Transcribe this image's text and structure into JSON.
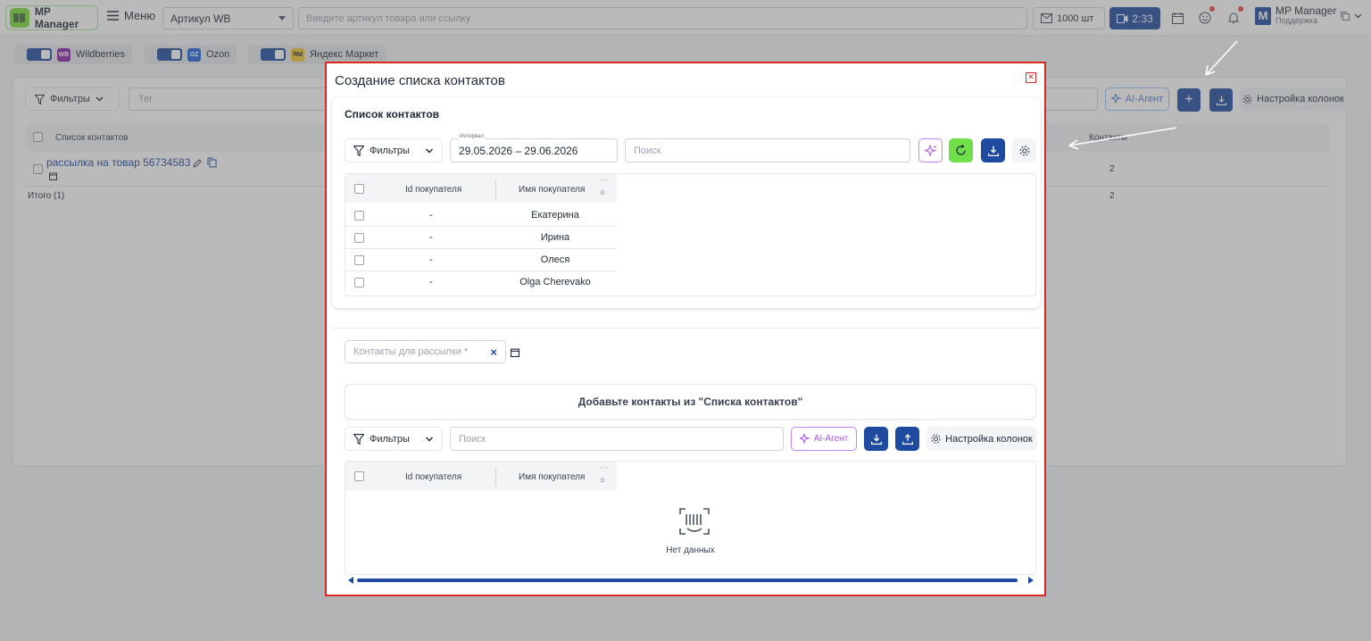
{
  "app": {
    "name": "MP Manager",
    "menu_label": "Меню"
  },
  "topbar": {
    "article_select": "Артикул WB",
    "article_placeholder": "Введите артикул товара или ссылку",
    "count": "1000 шт",
    "timer": "2:33",
    "profile_name": "MP Manager",
    "profile_sub": "Поддержка"
  },
  "marketplaces": [
    {
      "code": "WB",
      "label": "Wildberries",
      "color": "#8b1fa9"
    },
    {
      "code": "OZ",
      "label": "Ozon",
      "color": "#1e63d6"
    },
    {
      "code": "ЯМ",
      "label": "Яндекс Маркет",
      "color": "#f4c430"
    }
  ],
  "background": {
    "filters_label": "Фильтры",
    "tag_placeholder": "Тег",
    "ai_label": "AI-Агент",
    "columns_label": "Настройка колонок",
    "col_list": "Список контактов",
    "col_contacts": "Контакты",
    "row_name": "рассылка на товар 56734583",
    "row_value": "2",
    "total_label": "Итого (1)",
    "total_value": "2"
  },
  "modal": {
    "title": "Создание списка контактов",
    "section1": {
      "title": "Список контактов",
      "filters_label": "Фильтры",
      "date_label": "Интервал",
      "date_value": "29.05.2026 – 29.06.2026",
      "search_placeholder": "Поиск",
      "col_id": "Id покупателя",
      "col_name": "Имя покупателя",
      "rows": [
        {
          "id": "-",
          "name": "Екатерина"
        },
        {
          "id": "-",
          "name": "Ирина"
        },
        {
          "id": "-",
          "name": "Олеся"
        },
        {
          "id": "-",
          "name": "Olga Cherevako"
        }
      ]
    },
    "section2": {
      "chip_placeholder": "Контакты для рассылки *",
      "hint": "Добавьте контакты из \"Списка контактов\"",
      "filters_label": "Фильтры",
      "search_placeholder": "Поиск",
      "ai_label": "AI-Агент",
      "columns_label": "Настройка колонок",
      "col_id": "Id покупателя",
      "col_name": "Имя покупателя",
      "empty": "Нет данных"
    }
  },
  "colors": {
    "primary": "#1e4ba0",
    "accent_green": "#7cdc3a",
    "modal_border": "#dc2626"
  }
}
